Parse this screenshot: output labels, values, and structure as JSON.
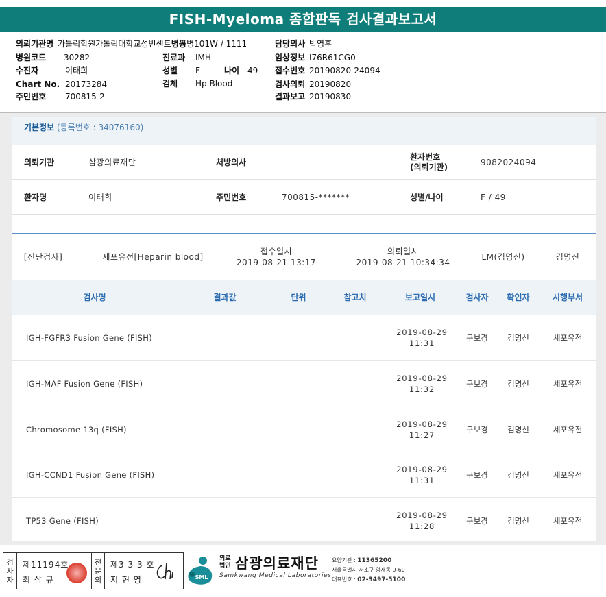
{
  "report_title": "FISH-Myeloma 종합판독 검사결과보고서",
  "header": {
    "institution": {
      "label": "의뢰기관명",
      "value": "가톨릭학원가톨릭대학교성빈센트병원"
    },
    "ward": {
      "label": "병동",
      "value": "병101W / 1111"
    },
    "doctor": {
      "label": "담당의사",
      "value": "박영훈"
    },
    "hospital_code": {
      "label": "병원코드",
      "value": "30282"
    },
    "department": {
      "label": "진료과",
      "value": "IMH"
    },
    "clinical_info": {
      "label": "임상정보",
      "value": "I76R61CG0"
    },
    "sample_collector": {
      "label": "수진자",
      "value": "이태희"
    },
    "sex": {
      "label": "성별",
      "value": "F"
    },
    "age": {
      "label": "나이",
      "value": "49"
    },
    "receipt_no": {
      "label": "접수번호",
      "value": "20190820-24094"
    },
    "chart_no": {
      "label": "Chart No.",
      "value": "20173284"
    },
    "specimen": {
      "label": "검체",
      "value": "Hp Blood"
    },
    "test_request": {
      "label": "검사의뢰",
      "value": "20190820"
    },
    "resident_no": {
      "label": "주민번호",
      "value": "700815-2"
    },
    "result_report": {
      "label": "결과보고",
      "value": "20190830"
    }
  },
  "basic_info": {
    "title": "기본정보",
    "reg_no": "(등록번호 : 34076160)",
    "institution_label": "의뢰기관",
    "institution_value": "삼광의료재단",
    "prescriber_label": "처방의사",
    "prescriber_value": "",
    "patient_no_label_1": "환자번호",
    "patient_no_label_2": "(의뢰기관)",
    "patient_no_value": "9082024094",
    "patient_name_label": "환자명",
    "patient_name_value": "이태희",
    "resident_label": "주민번호",
    "resident_value": "700815-*******",
    "sex_age_label": "성별/나이",
    "sex_age_value": "F / 49"
  },
  "order": {
    "category": "[진단검사]",
    "test": "세포유전[Heparin blood]",
    "receipt_label": "접수일시",
    "receipt_value": "2019-08-21 13:17",
    "request_label": "의뢰일시",
    "request_value": "2019-08-21 10:34:34",
    "lm": "LM(김명신)",
    "person": "김명신"
  },
  "result_columns": [
    "검사명",
    "결과값",
    "단위",
    "참고치",
    "보고일시",
    "검사자",
    "확인자",
    "시행부서"
  ],
  "results": [
    {
      "name": "IGH-FGFR3 Fusion Gene (FISH)",
      "result": "",
      "unit": "",
      "ref": "",
      "date": "2019-08-29",
      "time": "11:31",
      "tester": "구보경",
      "confirmer": "김명신",
      "dept": "세포유전"
    },
    {
      "name": "IGH-MAF Fusion Gene (FISH)",
      "result": "",
      "unit": "",
      "ref": "",
      "date": "2019-08-29",
      "time": "11:32",
      "tester": "구보경",
      "confirmer": "김명신",
      "dept": "세포유전"
    },
    {
      "name": "Chromosome 13q (FISH)",
      "result": "",
      "unit": "",
      "ref": "",
      "date": "2019-08-29",
      "time": "11:27",
      "tester": "구보경",
      "confirmer": "김명신",
      "dept": "세포유전"
    },
    {
      "name": "IGH-CCND1 Fusion Gene (FISH)",
      "result": "",
      "unit": "",
      "ref": "",
      "date": "2019-08-29",
      "time": "11:31",
      "tester": "구보경",
      "confirmer": "김명신",
      "dept": "세포유전"
    },
    {
      "name": "TP53 Gene (FISH)",
      "result": "",
      "unit": "",
      "ref": "",
      "date": "2019-08-29",
      "time": "11:28",
      "tester": "구보경",
      "confirmer": "김명신",
      "dept": "세포유전"
    }
  ],
  "footer": {
    "col1_vertical": [
      "검",
      "사",
      "자"
    ],
    "col1_license": "제11194호",
    "col1_name": "최 삼 규",
    "col2_vertical": [
      "전",
      "문",
      "의"
    ],
    "col2_license": "제3 3 3 호",
    "col2_name": "지 현 영",
    "signature": "ch",
    "logo_badge": "SML",
    "brand_small_1": "의료",
    "brand_small_2": "법인",
    "brand_name": "삼광의료재단",
    "brand_en": "Samkwang Medical Laboratories",
    "care_code_label": "요양기관 : ",
    "care_code": "11365200",
    "address": "서울특별시 서초구 양재동 9-60",
    "phone_label": "대표번호 : ",
    "phone": "02-3497-5100"
  },
  "colors": {
    "title_bar": "#0f7d79",
    "header_accent": "#2b6cb0",
    "seal": "#e35a4f",
    "logo": "#1a8f99"
  }
}
